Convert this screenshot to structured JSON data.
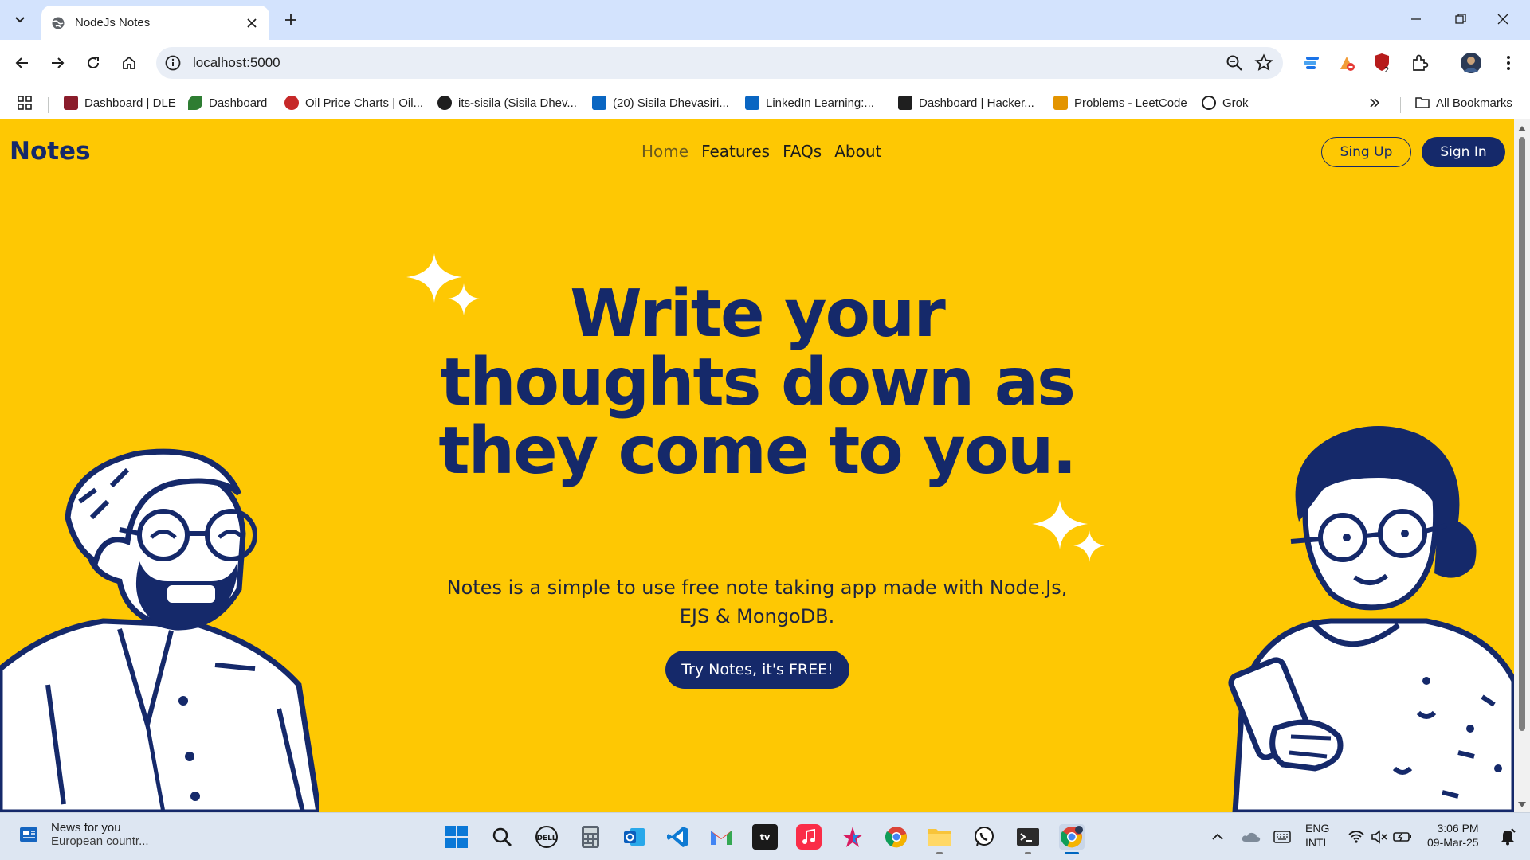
{
  "browser": {
    "tab_title": "NodeJs Notes",
    "url": "localhost:5000",
    "bookmarks": [
      {
        "label": "Dashboard | DLE",
        "color": "#8a1c2b"
      },
      {
        "label": "Dashboard",
        "color": "#2e7d32"
      },
      {
        "label": "Oil Price Charts | Oil...",
        "color": "#c62828"
      },
      {
        "label": "its-sisila (Sisila Dhev...",
        "color": "#1f1f1f"
      },
      {
        "label": "(20) Sisila Dhevasiri...",
        "color": "#0a66c2"
      },
      {
        "label": "LinkedIn Learning:...",
        "color": "#0a66c2"
      },
      {
        "label": "Dashboard | Hacker...",
        "color": "#1f1f1f"
      },
      {
        "label": "Problems - LeetCode",
        "color": "#e39400"
      },
      {
        "label": "Grok",
        "color": "#1f1f1f"
      }
    ],
    "all_bookmarks": "All Bookmarks"
  },
  "site": {
    "logo": "Notes",
    "nav": [
      "Home",
      "Features",
      "FAQs",
      "About"
    ],
    "signup": "Sing Up",
    "signin": "Sign In",
    "hero_title": "Write your thoughts down as they come to you.",
    "hero_sub": "Notes is a simple to use free note taking app made with Node.Js, EJS & MongoDB.",
    "cta": "Try Notes, it's FREE!",
    "colors": {
      "background": "#fec803",
      "primary": "#15296a"
    }
  },
  "taskbar": {
    "news_title": "News for you",
    "news_sub": "European countr...",
    "lang_1": "ENG",
    "lang_2": "INTL",
    "time": "3:06 PM",
    "date": "09-Mar-25"
  }
}
